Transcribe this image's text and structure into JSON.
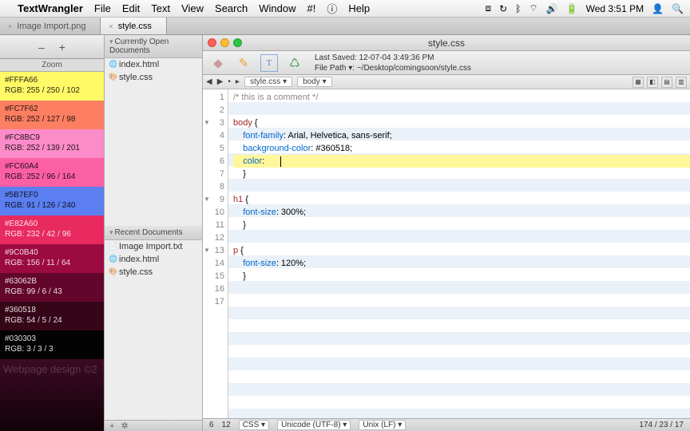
{
  "menubar": {
    "app": "TextWrangler",
    "items": [
      "File",
      "Edit",
      "Text",
      "View",
      "Search",
      "Window",
      "#!",
      "ⓘ",
      "Help"
    ],
    "clock": "Wed 3:51 PM"
  },
  "tabs": [
    {
      "label": "Image Import.png",
      "active": false
    },
    {
      "label": "style.css",
      "active": true
    }
  ],
  "zoom": {
    "label": "Zoom",
    "minus": "–",
    "plus": "+"
  },
  "swatches": [
    {
      "hex": "#FFFA66",
      "rgb": "RGB: 255 / 250 / 102",
      "bg": "#FFFA66",
      "dark": false
    },
    {
      "hex": "#FC7F62",
      "rgb": "RGB: 252 / 127 / 98",
      "bg": "#FC7F62",
      "dark": false
    },
    {
      "hex": "#FC8BC9",
      "rgb": "RGB: 252 / 139 / 201",
      "bg": "#FC8BC9",
      "dark": false
    },
    {
      "hex": "#FC60A4",
      "rgb": "RGB: 252 / 96 / 164",
      "bg": "#FC60A4",
      "dark": false
    },
    {
      "hex": "#5B7EF0",
      "rgb": "RGB: 91 / 126 / 240",
      "bg": "#5B7EF0",
      "dark": false
    },
    {
      "hex": "#E82A60",
      "rgb": "RGB: 232 / 42 / 96",
      "bg": "#E82A60",
      "dark": true
    },
    {
      "hex": "#9C0B40",
      "rgb": "RGB: 156 / 11 / 64",
      "bg": "#9C0B40",
      "dark": true
    },
    {
      "hex": "#63062B",
      "rgb": "RGB: 99 / 6 / 43",
      "bg": "#63062B",
      "dark": true
    },
    {
      "hex": "#360518",
      "rgb": "RGB: 54 / 5 / 24",
      "bg": "#360518",
      "dark": true
    },
    {
      "hex": "#030303",
      "rgb": "RGB: 3 / 3 / 3",
      "bg": "#030303",
      "dark": true
    }
  ],
  "bgtext": "Webpage design ©2",
  "drawer": {
    "open_head": "Currently Open Documents",
    "open": [
      {
        "n": "index.html",
        "t": "html"
      },
      {
        "n": "style.css",
        "t": "css"
      }
    ],
    "recent_head": "Recent Documents",
    "recent": [
      {
        "n": "Image Import.txt",
        "t": ""
      },
      {
        "n": "index.html",
        "t": "html"
      },
      {
        "n": "style.css",
        "t": "css"
      }
    ],
    "plus": "+",
    "gear": "✲"
  },
  "editor": {
    "title": "style.css",
    "saved_label": "Last Saved:",
    "saved_val": "12-07-04 3:49:36 PM",
    "path_label": "File Path ▾:",
    "path_val": "~/Desktop/comingsoon/style.css",
    "nav_file": "style.css",
    "nav_scope": "body",
    "nav_back": "◀",
    "nav_fwd": "▶",
    "nav_bullet": "•",
    "nav_tri": "▸"
  },
  "code": {
    "lines": [
      {
        "n": 1,
        "html": "<span class='c-comment'>/* this is a comment */</span>"
      },
      {
        "n": 2,
        "html": ""
      },
      {
        "n": 3,
        "html": "<span class='c-sel'>body</span> {",
        "fold": true
      },
      {
        "n": 4,
        "html": "    <span class='c-prop'>font-family</span>: Arial, Helvetica, sans-serif;"
      },
      {
        "n": 5,
        "html": "    <span class='c-prop'>background-color</span>: #360518;"
      },
      {
        "n": 6,
        "html": "    <span class='c-prop'>color</span>:",
        "hl": true,
        "caret": true
      },
      {
        "n": 7,
        "html": "    }"
      },
      {
        "n": 8,
        "html": ""
      },
      {
        "n": 9,
        "html": "<span class='c-sel'>h1</span> {",
        "fold": true
      },
      {
        "n": 10,
        "html": "    <span class='c-prop'>font-size</span>: 300%;"
      },
      {
        "n": 11,
        "html": "    }"
      },
      {
        "n": 12,
        "html": ""
      },
      {
        "n": 13,
        "html": "<span class='c-sel'>p</span> {",
        "fold": true
      },
      {
        "n": 14,
        "html": "    <span class='c-prop'>font-size</span>: 120%;"
      },
      {
        "n": 15,
        "html": "    }"
      },
      {
        "n": 16,
        "html": ""
      },
      {
        "n": 17,
        "html": ""
      }
    ]
  },
  "status": {
    "line": "6",
    "col": "12",
    "lang": "CSS",
    "enc": "Unicode (UTF-8)",
    "le": "Unix (LF)",
    "counts": "174 / 23 / 17"
  }
}
